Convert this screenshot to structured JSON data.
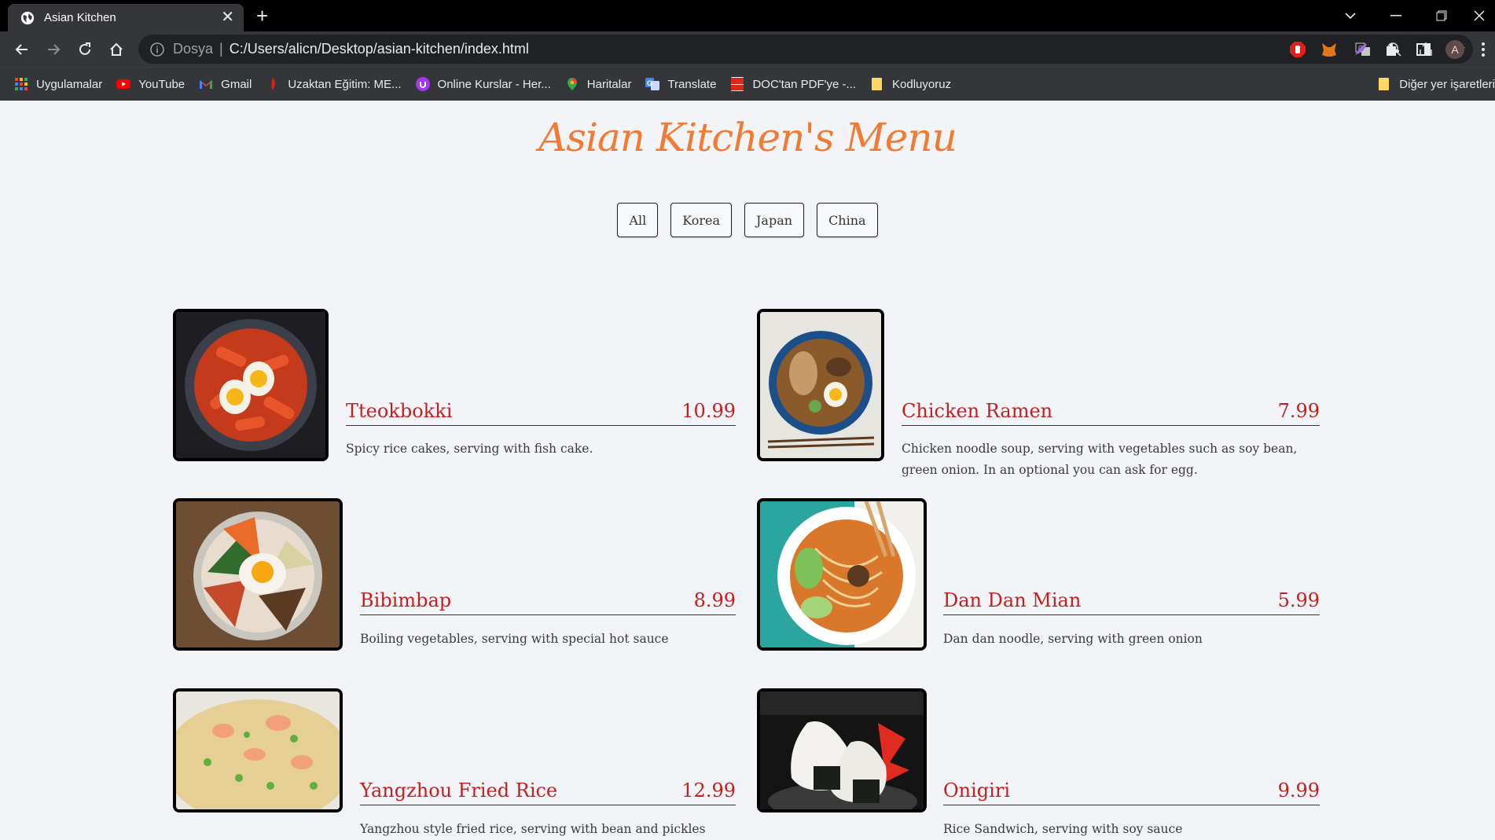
{
  "browser": {
    "tab_title": "Asian Kitchen",
    "url_scheme": "Dosya",
    "url_path": "C:/Users/alicn/Desktop/asian-kitchen/index.html",
    "profile_initial": "A",
    "bookmarks": [
      {
        "label": "Uygulamalar",
        "icon": "apps-grid-icon"
      },
      {
        "label": "YouTube",
        "icon": "youtube-icon"
      },
      {
        "label": "Gmail",
        "icon": "gmail-icon"
      },
      {
        "label": "Uzaktan Eğitim: ME...",
        "icon": "flame-icon"
      },
      {
        "label": "Online Kurslar - Her...",
        "icon": "udemy-icon"
      },
      {
        "label": "Haritalar",
        "icon": "maps-pin-icon"
      },
      {
        "label": "Translate",
        "icon": "translate-icon"
      },
      {
        "label": "DOC'tan PDF'ye -...",
        "icon": "doc-icon"
      },
      {
        "label": "Kodluyoruz",
        "icon": "folder-icon"
      }
    ],
    "other_bookmarks": "Diğer yer işaretleri"
  },
  "page": {
    "title": "Asian Kitchen's Menu",
    "filters": [
      "All",
      "Korea",
      "Japan",
      "China"
    ],
    "items": [
      {
        "name": "Tteokbokki",
        "price": "10.99",
        "desc": "Spicy rice cakes, serving with fish cake."
      },
      {
        "name": "Chicken Ramen",
        "price": "7.99",
        "desc": "Chicken noodle soup, serving with vegetables such as soy bean, green onion. In an optional you can ask for egg."
      },
      {
        "name": "Bibimbap",
        "price": "8.99",
        "desc": "Boiling vegetables, serving with special hot sauce"
      },
      {
        "name": "Dan Dan Mian",
        "price": "5.99",
        "desc": "Dan dan noodle, serving with green onion"
      },
      {
        "name": "Yangzhou Fried Rice",
        "price": "12.99",
        "desc": "Yangzhou style fried rice, serving with bean and pickles"
      },
      {
        "name": "Onigiri",
        "price": "9.99",
        "desc": "Rice Sandwich, serving with soy sauce"
      }
    ]
  }
}
